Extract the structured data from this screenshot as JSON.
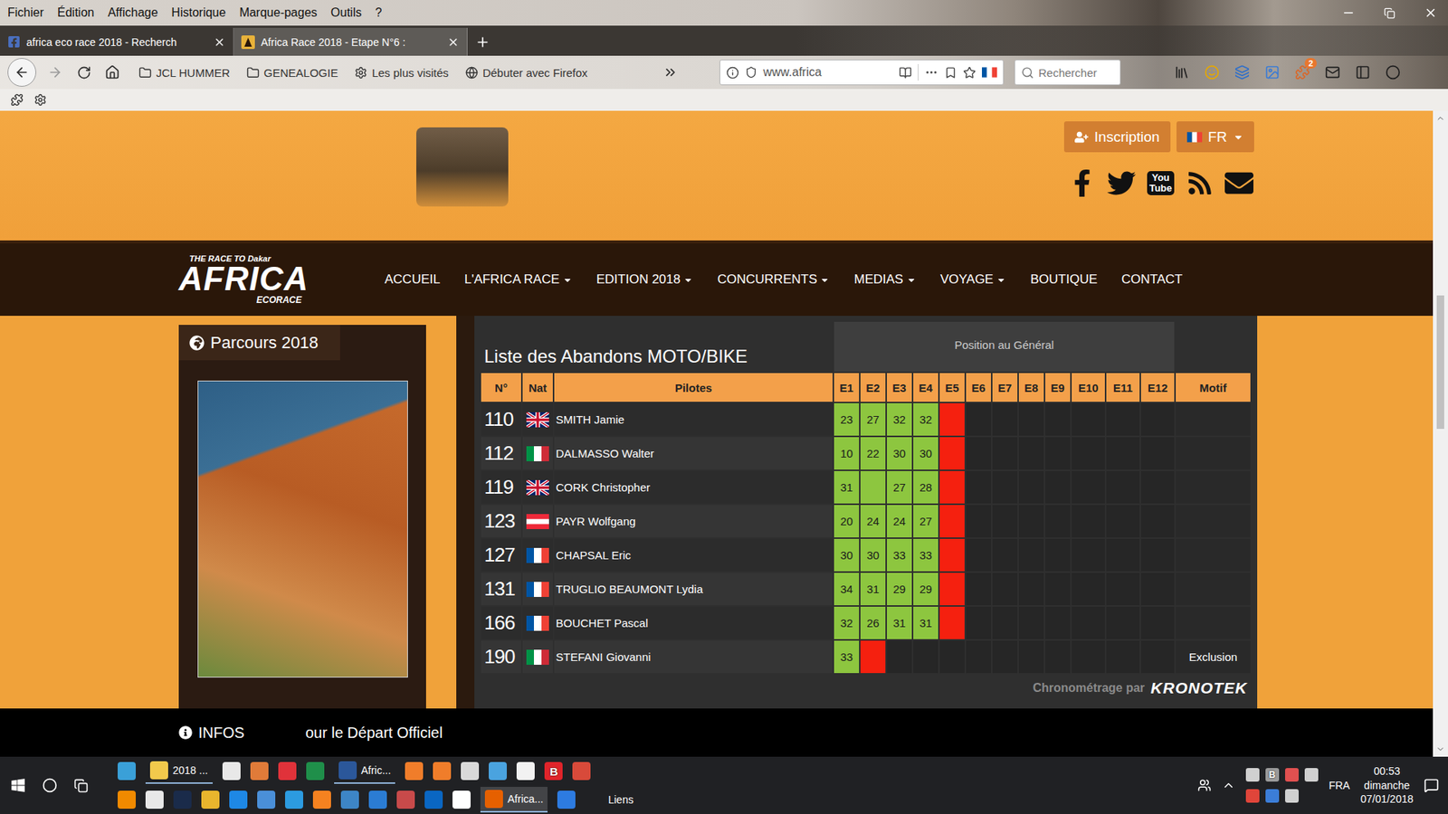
{
  "menubar": {
    "items": [
      "Fichier",
      "Édition",
      "Affichage",
      "Historique",
      "Marque-pages",
      "Outils",
      "?"
    ]
  },
  "tabs": [
    {
      "label": "africa eco race 2018 - Recherch",
      "kind": "facebook",
      "selected": false
    },
    {
      "label": "Africa Race 2018 - Etape N°6 :",
      "kind": "site",
      "selected": true
    }
  ],
  "bookmarks": [
    {
      "label": "JCL HUMMER",
      "kind": "folder"
    },
    {
      "label": "GENEALOGIE",
      "kind": "folder"
    },
    {
      "label": "Les plus visités",
      "kind": "gear"
    },
    {
      "label": "Débuter avec Firefox",
      "kind": "globe"
    }
  ],
  "urlbar": {
    "url": "www.africa"
  },
  "search": {
    "placeholder": "Rechercher"
  },
  "toolbar": {
    "badge": "2"
  },
  "site": {
    "inscription": "Inscription",
    "language": "FR",
    "social": [
      {
        "kind": "facebook"
      },
      {
        "kind": "twitter"
      },
      {
        "kind": "youtube",
        "label": "You Tube"
      },
      {
        "kind": "rss"
      },
      {
        "kind": "mail"
      }
    ],
    "logo": {
      "tagline": "THE RACE TO Dakar",
      "name": "AFRICA",
      "sub": "ECORACE"
    },
    "nav": [
      {
        "label": "ACCUEIL",
        "dropdown": false
      },
      {
        "label": "L'AFRICA RACE",
        "dropdown": true
      },
      {
        "label": "EDITION 2018",
        "dropdown": true
      },
      {
        "label": "CONCURRENTS",
        "dropdown": true
      },
      {
        "label": "MEDIAS",
        "dropdown": true
      },
      {
        "label": "VOYAGE",
        "dropdown": true
      },
      {
        "label": "BOUTIQUE",
        "dropdown": false
      },
      {
        "label": "CONTACT",
        "dropdown": false
      }
    ]
  },
  "sidebar": {
    "title": "Parcours 2018"
  },
  "table": {
    "title": "Liste des Abandons MOTO/BIKE",
    "group": "Position au Général",
    "columns": [
      "N°",
      "Nat",
      "Pilotes",
      "E1",
      "E2",
      "E3",
      "E4",
      "E5",
      "E6",
      "E7",
      "E8",
      "E9",
      "E10",
      "E11",
      "E12",
      "Motif"
    ],
    "rows": [
      {
        "number": "110",
        "nat": "uk",
        "pilot": "SMITH Jamie",
        "motif": "",
        "stages": [
          {
            "text": "23",
            "kind": "ranked"
          },
          {
            "text": "27",
            "kind": "ranked"
          },
          {
            "text": "32",
            "kind": "ranked"
          },
          {
            "text": "32",
            "kind": "ranked"
          },
          {
            "text": "",
            "kind": "abandon"
          },
          {
            "text": "",
            "kind": "none"
          },
          {
            "text": "",
            "kind": "none"
          },
          {
            "text": "",
            "kind": "none"
          },
          {
            "text": "",
            "kind": "none"
          },
          {
            "text": "",
            "kind": "none"
          },
          {
            "text": "",
            "kind": "none"
          },
          {
            "text": "",
            "kind": "none"
          }
        ]
      },
      {
        "number": "112",
        "nat": "it",
        "pilot": "DALMASSO Walter",
        "motif": "",
        "stages": [
          {
            "text": "10",
            "kind": "ranked"
          },
          {
            "text": "22",
            "kind": "ranked"
          },
          {
            "text": "30",
            "kind": "ranked"
          },
          {
            "text": "30",
            "kind": "ranked"
          },
          {
            "text": "",
            "kind": "abandon"
          },
          {
            "text": "",
            "kind": "none"
          },
          {
            "text": "",
            "kind": "none"
          },
          {
            "text": "",
            "kind": "none"
          },
          {
            "text": "",
            "kind": "none"
          },
          {
            "text": "",
            "kind": "none"
          },
          {
            "text": "",
            "kind": "none"
          },
          {
            "text": "",
            "kind": "none"
          }
        ]
      },
      {
        "number": "119",
        "nat": "uk",
        "pilot": "CORK Christopher",
        "motif": "",
        "stages": [
          {
            "text": "31",
            "kind": "ranked"
          },
          {
            "text": "",
            "kind": "ranked"
          },
          {
            "text": "27",
            "kind": "ranked"
          },
          {
            "text": "28",
            "kind": "ranked"
          },
          {
            "text": "",
            "kind": "abandon"
          },
          {
            "text": "",
            "kind": "none"
          },
          {
            "text": "",
            "kind": "none"
          },
          {
            "text": "",
            "kind": "none"
          },
          {
            "text": "",
            "kind": "none"
          },
          {
            "text": "",
            "kind": "none"
          },
          {
            "text": "",
            "kind": "none"
          },
          {
            "text": "",
            "kind": "none"
          }
        ]
      },
      {
        "number": "123",
        "nat": "at",
        "pilot": "PAYR Wolfgang",
        "motif": "",
        "stages": [
          {
            "text": "20",
            "kind": "ranked"
          },
          {
            "text": "24",
            "kind": "ranked"
          },
          {
            "text": "24",
            "kind": "ranked"
          },
          {
            "text": "27",
            "kind": "ranked"
          },
          {
            "text": "",
            "kind": "abandon"
          },
          {
            "text": "",
            "kind": "none"
          },
          {
            "text": "",
            "kind": "none"
          },
          {
            "text": "",
            "kind": "none"
          },
          {
            "text": "",
            "kind": "none"
          },
          {
            "text": "",
            "kind": "none"
          },
          {
            "text": "",
            "kind": "none"
          },
          {
            "text": "",
            "kind": "none"
          }
        ]
      },
      {
        "number": "127",
        "nat": "fr",
        "pilot": "CHAPSAL Eric",
        "motif": "",
        "stages": [
          {
            "text": "30",
            "kind": "ranked"
          },
          {
            "text": "30",
            "kind": "ranked"
          },
          {
            "text": "33",
            "kind": "ranked"
          },
          {
            "text": "33",
            "kind": "ranked"
          },
          {
            "text": "",
            "kind": "abandon"
          },
          {
            "text": "",
            "kind": "none"
          },
          {
            "text": "",
            "kind": "none"
          },
          {
            "text": "",
            "kind": "none"
          },
          {
            "text": "",
            "kind": "none"
          },
          {
            "text": "",
            "kind": "none"
          },
          {
            "text": "",
            "kind": "none"
          },
          {
            "text": "",
            "kind": "none"
          }
        ]
      },
      {
        "number": "131",
        "nat": "fr",
        "pilot": "TRUGLIO BEAUMONT Lydia",
        "motif": "",
        "stages": [
          {
            "text": "34",
            "kind": "ranked"
          },
          {
            "text": "31",
            "kind": "ranked"
          },
          {
            "text": "29",
            "kind": "ranked"
          },
          {
            "text": "29",
            "kind": "ranked"
          },
          {
            "text": "",
            "kind": "abandon"
          },
          {
            "text": "",
            "kind": "none"
          },
          {
            "text": "",
            "kind": "none"
          },
          {
            "text": "",
            "kind": "none"
          },
          {
            "text": "",
            "kind": "none"
          },
          {
            "text": "",
            "kind": "none"
          },
          {
            "text": "",
            "kind": "none"
          },
          {
            "text": "",
            "kind": "none"
          }
        ]
      },
      {
        "number": "166",
        "nat": "fr",
        "pilot": "BOUCHET Pascal",
        "motif": "",
        "stages": [
          {
            "text": "32",
            "kind": "ranked"
          },
          {
            "text": "26",
            "kind": "ranked"
          },
          {
            "text": "31",
            "kind": "ranked"
          },
          {
            "text": "31",
            "kind": "ranked"
          },
          {
            "text": "",
            "kind": "abandon"
          },
          {
            "text": "",
            "kind": "none"
          },
          {
            "text": "",
            "kind": "none"
          },
          {
            "text": "",
            "kind": "none"
          },
          {
            "text": "",
            "kind": "none"
          },
          {
            "text": "",
            "kind": "none"
          },
          {
            "text": "",
            "kind": "none"
          },
          {
            "text": "",
            "kind": "none"
          }
        ]
      },
      {
        "number": "190",
        "nat": "it",
        "pilot": "STEFANI Giovanni",
        "motif": "Exclusion",
        "stages": [
          {
            "text": "33",
            "kind": "ranked"
          },
          {
            "text": "",
            "kind": "abandon"
          },
          {
            "text": "",
            "kind": "none"
          },
          {
            "text": "",
            "kind": "none"
          },
          {
            "text": "",
            "kind": "none"
          },
          {
            "text": "",
            "kind": "none"
          },
          {
            "text": "",
            "kind": "none"
          },
          {
            "text": "",
            "kind": "none"
          },
          {
            "text": "",
            "kind": "none"
          },
          {
            "text": "",
            "kind": "none"
          },
          {
            "text": "",
            "kind": "none"
          },
          {
            "text": "",
            "kind": "none"
          }
        ]
      }
    ]
  },
  "timing": {
    "label": "Chronométrage par",
    "brand": "KRONOTEK"
  },
  "infobar": {
    "label": "INFOS",
    "ticker": "our le Départ Officiel"
  },
  "taskbar": {
    "row1": [
      {
        "kind": "icon",
        "color": "#3aa0d8"
      },
      {
        "kind": "app",
        "label": "2018 ...",
        "color": "#f2c94c",
        "selected": false
      },
      {
        "kind": "icon",
        "color": "#e8e8e8"
      },
      {
        "kind": "icon",
        "color": "#e07b39"
      },
      {
        "kind": "icon",
        "color": "#e0323a"
      },
      {
        "kind": "icon",
        "color": "#1f8f4a"
      },
      {
        "kind": "app",
        "label": "Afric...",
        "color": "#2b579a",
        "selected": false
      },
      {
        "kind": "icon",
        "color": "#f07d2a"
      },
      {
        "kind": "icon",
        "color": "#f07d2a"
      },
      {
        "kind": "icon",
        "color": "#d9d9d9"
      },
      {
        "kind": "icon",
        "color": "#4aa3df"
      },
      {
        "kind": "icon",
        "color": "#f2f2f2"
      },
      {
        "kind": "icon",
        "color": "#e0242a",
        "glyph": "B"
      },
      {
        "kind": "icon",
        "color": "#d84a3a"
      }
    ],
    "row2": [
      {
        "kind": "icon",
        "color": "#f08a00"
      },
      {
        "kind": "icon",
        "color": "#e8e8e8"
      },
      {
        "kind": "icon",
        "color": "#1a2b4a"
      },
      {
        "kind": "icon",
        "color": "#e9b52d"
      },
      {
        "kind": "icon",
        "color": "#1e88e5"
      },
      {
        "kind": "icon",
        "color": "#4a8fd8"
      },
      {
        "kind": "icon",
        "color": "#2c9be0"
      },
      {
        "kind": "icon",
        "color": "#f58220"
      },
      {
        "kind": "icon",
        "color": "#3d85c6"
      },
      {
        "kind": "icon",
        "color": "#2b7cd3"
      },
      {
        "kind": "icon",
        "color": "#c84a4a"
      },
      {
        "kind": "icon",
        "color": "#0a66c2"
      },
      {
        "kind": "icon",
        "color": "#ffffff"
      },
      {
        "kind": "app",
        "label": "Africa...",
        "color": "#e66000",
        "selected": true
      },
      {
        "kind": "icon",
        "color": "#2d7be0"
      }
    ],
    "toolbar_label": "Liens",
    "tray_row1": [
      {
        "color": "#d0d0d0"
      },
      {
        "color": "#9a9a9a",
        "glyph": "B"
      },
      {
        "color": "#e05050"
      },
      {
        "color": "#d0d0d0"
      }
    ],
    "tray_row2": [
      {
        "color": "#e0453a"
      },
      {
        "color": "#3b7dd8"
      },
      {
        "color": "#d0d0d0"
      }
    ],
    "language": "FRA",
    "clock": {
      "time": "00:53",
      "day": "dimanche",
      "date": "07/01/2018"
    }
  }
}
